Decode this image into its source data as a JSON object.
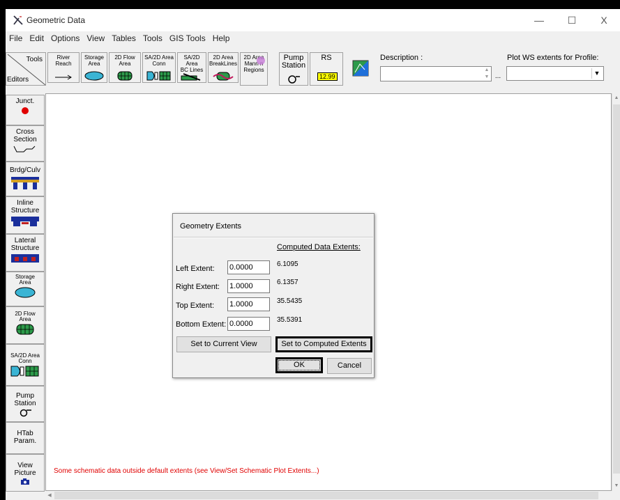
{
  "window": {
    "title": "Geometric Data",
    "controls": {
      "minimize": "—",
      "maximize": "☐",
      "close": "X"
    }
  },
  "menu": [
    "File",
    "Edit",
    "Options",
    "View",
    "Tables",
    "Tools",
    "GIS Tools",
    "Help"
  ],
  "toolbar": {
    "tools_label": "Tools",
    "editors_label": "Editors",
    "buttons": [
      {
        "label": "River\nReach",
        "icon": "river-reach-arrow-icon"
      },
      {
        "label": "Storage\nArea",
        "icon": "storage-area-icon"
      },
      {
        "label": "2D Flow\nArea",
        "icon": "2d-flow-area-icon"
      },
      {
        "label": "SA/2D Area\nConn",
        "icon": "sa-2d-conn-icon"
      },
      {
        "label": "SA/2D Area\nBC Lines",
        "icon": "bc-lines-icon"
      },
      {
        "label": "2D Area\nBreakLines",
        "icon": "breaklines-icon"
      },
      {
        "label": "2D Area\nMann n\nRegions",
        "icon": "manning-regions-icon"
      },
      {
        "label": "Pump\nStation",
        "icon": "pump-station-icon"
      },
      {
        "label": "RS",
        "badge": "12.99",
        "icon": "river-station-icon"
      },
      {
        "label": "",
        "icon": "georef-map-icon"
      }
    ],
    "description_label": "Description :",
    "description_value": "",
    "description_button": "...",
    "plot_ws_label": "Plot WS extents for Profile:",
    "plot_ws_value": ""
  },
  "sidebar": [
    {
      "label": "Junct.",
      "icon": "junction-red-dot-icon"
    },
    {
      "label": "Cross\nSection",
      "icon": "cross-section-icon"
    },
    {
      "label": "Brdg/Culv",
      "icon": "bridge-culvert-icon"
    },
    {
      "label": "Inline\nStructure",
      "icon": "inline-structure-icon"
    },
    {
      "label": "Lateral\nStructure",
      "icon": "lateral-structure-icon"
    },
    {
      "label": "Storage\nArea",
      "icon": "storage-area-icon"
    },
    {
      "label": "2D Flow\nArea",
      "icon": "2d-flow-area-icon"
    },
    {
      "label": "SA/2D Area\nConn",
      "icon": "sa-2d-conn-icon"
    },
    {
      "label": "Pump\nStation",
      "icon": "pump-station-icon"
    },
    {
      "label": "HTab\nParam.",
      "icon": ""
    },
    {
      "label": "View\nPicture",
      "icon": "camera-icon"
    }
  ],
  "status_message": "Some schematic data outside default extents (see View/Set Schematic Plot Extents...)",
  "dialog": {
    "title": "Geometry Extents",
    "computed_header": "Computed Data Extents:",
    "fields": [
      {
        "label": "Left Extent:",
        "value": "0.0000",
        "computed": "6.1095"
      },
      {
        "label": "Right Extent:",
        "value": "1.0000",
        "computed": "6.1357"
      },
      {
        "label": "Top Extent:",
        "value": "1.0000",
        "computed": "35.5435"
      },
      {
        "label": "Bottom Extent:",
        "value": "0.0000",
        "computed": "35.5391"
      }
    ],
    "set_current_view": "Set to Current View",
    "set_computed": "Set to Computed Extents",
    "ok": "OK",
    "cancel": "Cancel"
  },
  "colors": {
    "junction": "#e00000",
    "storage": "#3ab4d4",
    "flow2d": "#2c9a4a",
    "bridge": "#1a2f9c",
    "status_text": "#e00000"
  }
}
